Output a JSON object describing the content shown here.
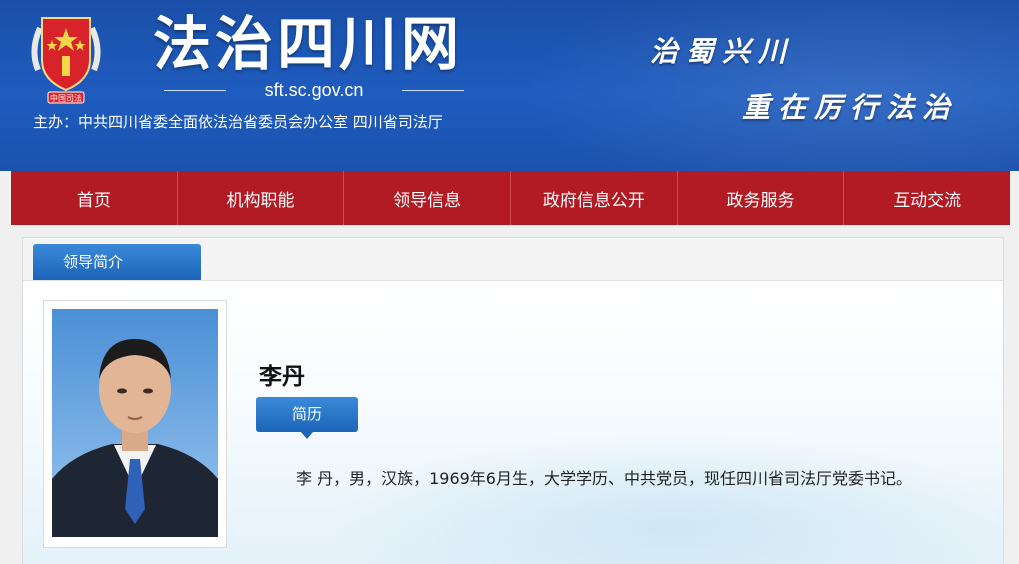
{
  "header": {
    "title": "法治四川网",
    "domain": "sft.sc.gov.cn",
    "sponsor": "主办：中共四川省委全面依法治省委员会办公室    四川省司法厅",
    "emblem_text": "中国司法",
    "slogan_line1": "治蜀兴川",
    "slogan_line2": "重在厉行法治"
  },
  "nav": {
    "items": [
      {
        "label": "首页"
      },
      {
        "label": "机构职能"
      },
      {
        "label": "领导信息"
      },
      {
        "label": "政府信息公开"
      },
      {
        "label": "政务服务"
      },
      {
        "label": "互动交流"
      }
    ]
  },
  "content": {
    "tab_label": "领导简介",
    "leader": {
      "name": "李丹",
      "resume_label": "简历",
      "bio": "李  丹，男，汉族，1969年6月生，大学学历、中共党员，现任四川省司法厅党委书记。"
    }
  },
  "colors": {
    "header_blue": "#1f5cbf",
    "nav_red": "#b21b24",
    "accent_blue": "#1c64b8"
  }
}
